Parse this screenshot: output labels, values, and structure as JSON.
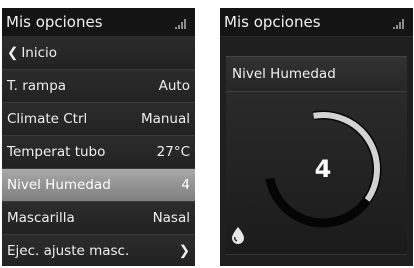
{
  "left_screen": {
    "title": "Mis opciones",
    "menu": [
      {
        "label": "Inicio",
        "value": ""
      },
      {
        "label": "T. rampa",
        "value": "Auto"
      },
      {
        "label": "Climate Ctrl",
        "value": "Manual"
      },
      {
        "label": "Temperat tubo",
        "value": "27°C"
      },
      {
        "label": "Nivel Humedad",
        "value": "4"
      },
      {
        "label": "Mascarilla",
        "value": "Nasal"
      },
      {
        "label": "Ejec. ajuste masc.",
        "value": ""
      }
    ]
  },
  "right_screen": {
    "title": "Mis opciones",
    "setting_title": "Nivel Humedad",
    "dial_value": "4",
    "dial_level_fraction": 0.5
  },
  "icons": [
    "signal-icon",
    "chevron-left-icon",
    "chevron-right-icon",
    "water-drop-icon"
  ],
  "colors": {
    "screen_bg": "#1f1f1f",
    "selected_row": "#9a9a9a",
    "dial_active": "#d2d2d2",
    "dial_inactive": "#050505"
  }
}
